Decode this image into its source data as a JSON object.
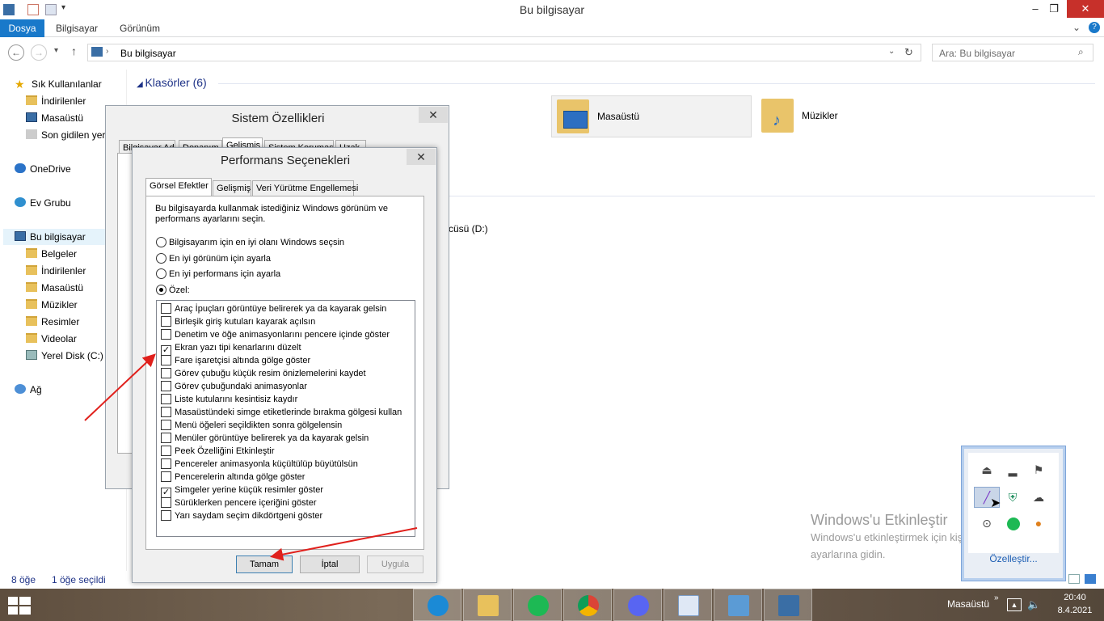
{
  "explorer": {
    "title": "Bu bilgisayar",
    "ribbon_tabs": [
      "Dosya",
      "Bilgisayar",
      "Görünüm"
    ],
    "address": "Bu bilgisayar",
    "search_placeholder": "Ara: Bu bilgisayar",
    "nav": {
      "quick_access": "Sık Kullanılanlar",
      "quick_items": [
        "İndirilenler",
        "Masaüstü",
        "Son gidilen yer"
      ],
      "onedrive": "OneDrive",
      "homegroup": "Ev Grubu",
      "this_pc": "Bu bilgisayar",
      "pc_items": [
        "Belgeler",
        "İndirilenler",
        "Masaüstü",
        "Müzikler",
        "Resimler",
        "Videolar",
        "Yerel Disk (C:)"
      ],
      "network": "Ağ"
    },
    "folders_header": "Klasörler (6)",
    "folders": [
      "Masaüstü",
      "Müzikler"
    ],
    "drive_partial": "cüsü (D:)",
    "status": {
      "count": "8 öğe",
      "selected": "1 öğe seçildi"
    }
  },
  "sys_dialog": {
    "title": "Sistem Özellikleri",
    "tabs": [
      "Bilgisayar Adı",
      "Donanım",
      "Gelişmiş",
      "Sistem Koruması",
      "Uzak"
    ]
  },
  "perf_dialog": {
    "title": "Performans Seçenekleri",
    "tabs": [
      "Görsel Efektler",
      "Gelişmiş",
      "Veri Yürütme Engellemesi"
    ],
    "description": "Bu bilgisayarda kullanmak istediğiniz Windows görünüm ve performans ayarlarını seçin.",
    "radios": [
      {
        "label": "Bilgisayarım için en iyi olanı Windows seçsin",
        "checked": false
      },
      {
        "label": "En iyi görünüm için ayarla",
        "checked": false
      },
      {
        "label": "En iyi performans için ayarla",
        "checked": false
      },
      {
        "label": "Özel:",
        "checked": true
      }
    ],
    "options": [
      {
        "label": "Araç İpuçları görüntüye belirerek ya da kayarak gelsin",
        "checked": false
      },
      {
        "label": "Birleşik giriş kutuları kayarak açılsın",
        "checked": false
      },
      {
        "label": "Denetim ve öğe animasyonlarını pencere içinde göster",
        "checked": false
      },
      {
        "label": "Ekran yazı tipi kenarlarını düzelt",
        "checked": true
      },
      {
        "label": "Fare işaretçisi altında gölge göster",
        "checked": false
      },
      {
        "label": "Görev çubuğu küçük resim önizlemelerini kaydet",
        "checked": false
      },
      {
        "label": "Görev çubuğundaki animasyonlar",
        "checked": false
      },
      {
        "label": "Liste kutularını kesintisiz kaydır",
        "checked": false
      },
      {
        "label": "Masaüstündeki simge etiketlerinde bırakma gölgesi kullan",
        "checked": false
      },
      {
        "label": "Menü öğeleri seçildikten sonra gölgelensin",
        "checked": false
      },
      {
        "label": "Menüler görüntüye belirerek ya da kayarak gelsin",
        "checked": false
      },
      {
        "label": "Peek Özelliğini Etkinleştir",
        "checked": false
      },
      {
        "label": "Pencereler animasyonla küçültülüp büyütülsün",
        "checked": false
      },
      {
        "label": "Pencerelerin altında gölge göster",
        "checked": false
      },
      {
        "label": "Simgeler yerine küçük resimler göster",
        "checked": true
      },
      {
        "label": "Sürüklerken pencere içeriğini göster",
        "checked": false
      },
      {
        "label": "Yarı saydam seçim dikdörtgeni göster",
        "checked": false
      }
    ],
    "buttons": {
      "ok": "Tamam",
      "cancel": "İptal",
      "apply": "Uygula"
    }
  },
  "watermark": {
    "line1": "Windows'u Etkinleştir",
    "line2": "Windows'u etkinleştirmek için kişisel bilgisayar",
    "line3": "ayarlarına gidin."
  },
  "tray_flyout": {
    "customize": "Özelleştir..."
  },
  "taskbar": {
    "location_label": "Masaüstü",
    "time": "20:40",
    "date": "8.4.2021",
    "apps": [
      "edge-icon",
      "file-explorer-icon",
      "spotify-icon",
      "chrome-icon",
      "discord-icon",
      "notepad-icon",
      "control-panel-icon",
      "remote-desktop-icon"
    ]
  },
  "colors": {
    "accent": "#1979ca",
    "arrow": "#e0201c",
    "close": "#c7302a"
  }
}
